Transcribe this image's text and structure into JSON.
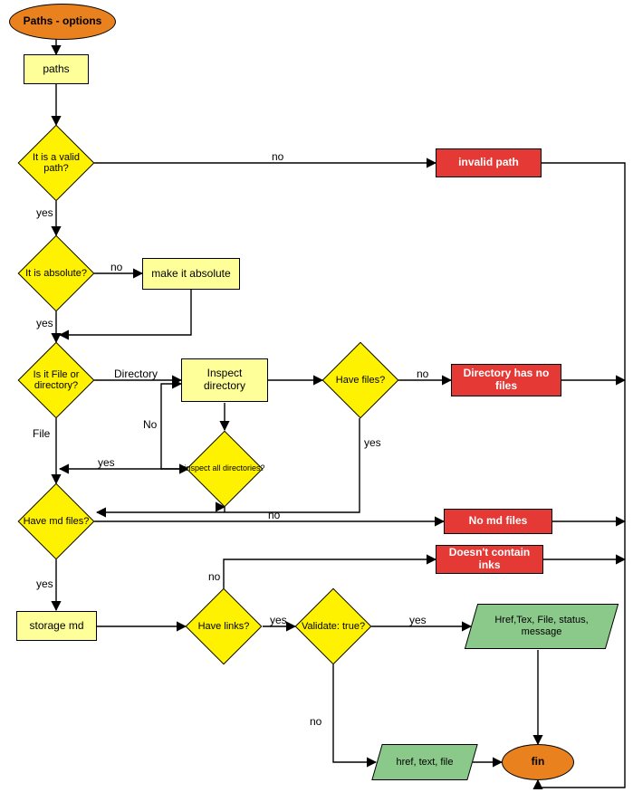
{
  "chart_data": {
    "type": "flowchart",
    "title": "Paths - options",
    "nodes": [
      {
        "id": "start",
        "type": "terminator",
        "label": "Paths - options"
      },
      {
        "id": "paths",
        "type": "process",
        "label": "paths"
      },
      {
        "id": "valid",
        "type": "decision",
        "label": "It is a valid path?"
      },
      {
        "id": "invalid",
        "type": "error",
        "label": "invalid path"
      },
      {
        "id": "absolute",
        "type": "decision",
        "label": "It is absolute?"
      },
      {
        "id": "makeabs",
        "type": "process",
        "label": "make it absolute"
      },
      {
        "id": "isfile",
        "type": "decision",
        "label": "Is it File or directory?"
      },
      {
        "id": "inspect",
        "type": "subprocess",
        "label": "Inspect directory"
      },
      {
        "id": "havefiles",
        "type": "decision",
        "label": "Have files?"
      },
      {
        "id": "nofiles",
        "type": "error",
        "label": "Directory has no files"
      },
      {
        "id": "inspectall",
        "type": "decision",
        "label": "inspect all directories?"
      },
      {
        "id": "havemd",
        "type": "decision",
        "label": "Have md files?"
      },
      {
        "id": "nomd",
        "type": "error",
        "label": "No md files"
      },
      {
        "id": "nolinks",
        "type": "error",
        "label": "Doesn't contain inks"
      },
      {
        "id": "storage",
        "type": "process",
        "label": "storage md"
      },
      {
        "id": "havelinks",
        "type": "decision",
        "label": "Have links?"
      },
      {
        "id": "validate",
        "type": "decision",
        "label": "Validate: true?"
      },
      {
        "id": "output_full",
        "type": "output",
        "label": "Href,Tex, File, status, message"
      },
      {
        "id": "output_basic",
        "type": "output",
        "label": "href, text, file"
      },
      {
        "id": "fin",
        "type": "terminator",
        "label": "fin"
      }
    ],
    "edges": [
      {
        "from": "start",
        "to": "paths",
        "label": ""
      },
      {
        "from": "paths",
        "to": "valid",
        "label": ""
      },
      {
        "from": "valid",
        "to": "absolute",
        "label": "yes"
      },
      {
        "from": "valid",
        "to": "invalid",
        "label": "no"
      },
      {
        "from": "invalid",
        "to": "fin",
        "label": ""
      },
      {
        "from": "absolute",
        "to": "isfile",
        "label": "yes"
      },
      {
        "from": "absolute",
        "to": "makeabs",
        "label": "no"
      },
      {
        "from": "makeabs",
        "to": "isfile",
        "label": ""
      },
      {
        "from": "isfile",
        "to": "havemd",
        "label": "File"
      },
      {
        "from": "isfile",
        "to": "inspect",
        "label": "Directory"
      },
      {
        "from": "inspect",
        "to": "havefiles",
        "label": ""
      },
      {
        "from": "inspect",
        "to": "inspectall",
        "label": ""
      },
      {
        "from": "inspectall",
        "to": "isfile",
        "label": "yes"
      },
      {
        "from": "inspectall",
        "to": "inspect",
        "label": "No"
      },
      {
        "from": "havefiles",
        "to": "havemd",
        "label": "yes"
      },
      {
        "from": "havefiles",
        "to": "nofiles",
        "label": "no"
      },
      {
        "from": "nofiles",
        "to": "fin",
        "label": ""
      },
      {
        "from": "havemd",
        "to": "storage",
        "label": "yes"
      },
      {
        "from": "havemd",
        "to": "nomd",
        "label": "no"
      },
      {
        "from": "nomd",
        "to": "fin",
        "label": ""
      },
      {
        "from": "nolinks",
        "to": "fin",
        "label": ""
      },
      {
        "from": "storage",
        "to": "havelinks",
        "label": ""
      },
      {
        "from": "havelinks",
        "to": "validate",
        "label": "yes"
      },
      {
        "from": "havelinks",
        "to": "nolinks",
        "label": "no"
      },
      {
        "from": "validate",
        "to": "output_full",
        "label": "yes"
      },
      {
        "from": "validate",
        "to": "output_basic",
        "label": "no"
      },
      {
        "from": "output_full",
        "to": "fin",
        "label": ""
      },
      {
        "from": "output_basic",
        "to": "fin",
        "label": ""
      }
    ]
  },
  "nodes": {
    "start": "Paths - options",
    "paths": "paths",
    "valid": "It is a valid path?",
    "invalid": "invalid path",
    "absolute": "It is absolute?",
    "makeabs": "make it absolute",
    "isfile": "Is it File or directory?",
    "inspect": "Inspect directory",
    "havefiles": "Have files?",
    "nofiles": "Directory has no files",
    "inspectall": "inspect all directories?",
    "havemd": "Have md files?",
    "nomd": "No md files",
    "nolinks": "Doesn't contain inks",
    "storage": "storage md",
    "havelinks": "Have links?",
    "validate": "Validate: true?",
    "output_full": "Href,Tex, File, status, message",
    "output_basic": "href, text, file",
    "fin": "fin"
  },
  "labels": {
    "yes": "yes",
    "no": "no",
    "File": "File",
    "Directory": "Directory",
    "No": "No"
  }
}
